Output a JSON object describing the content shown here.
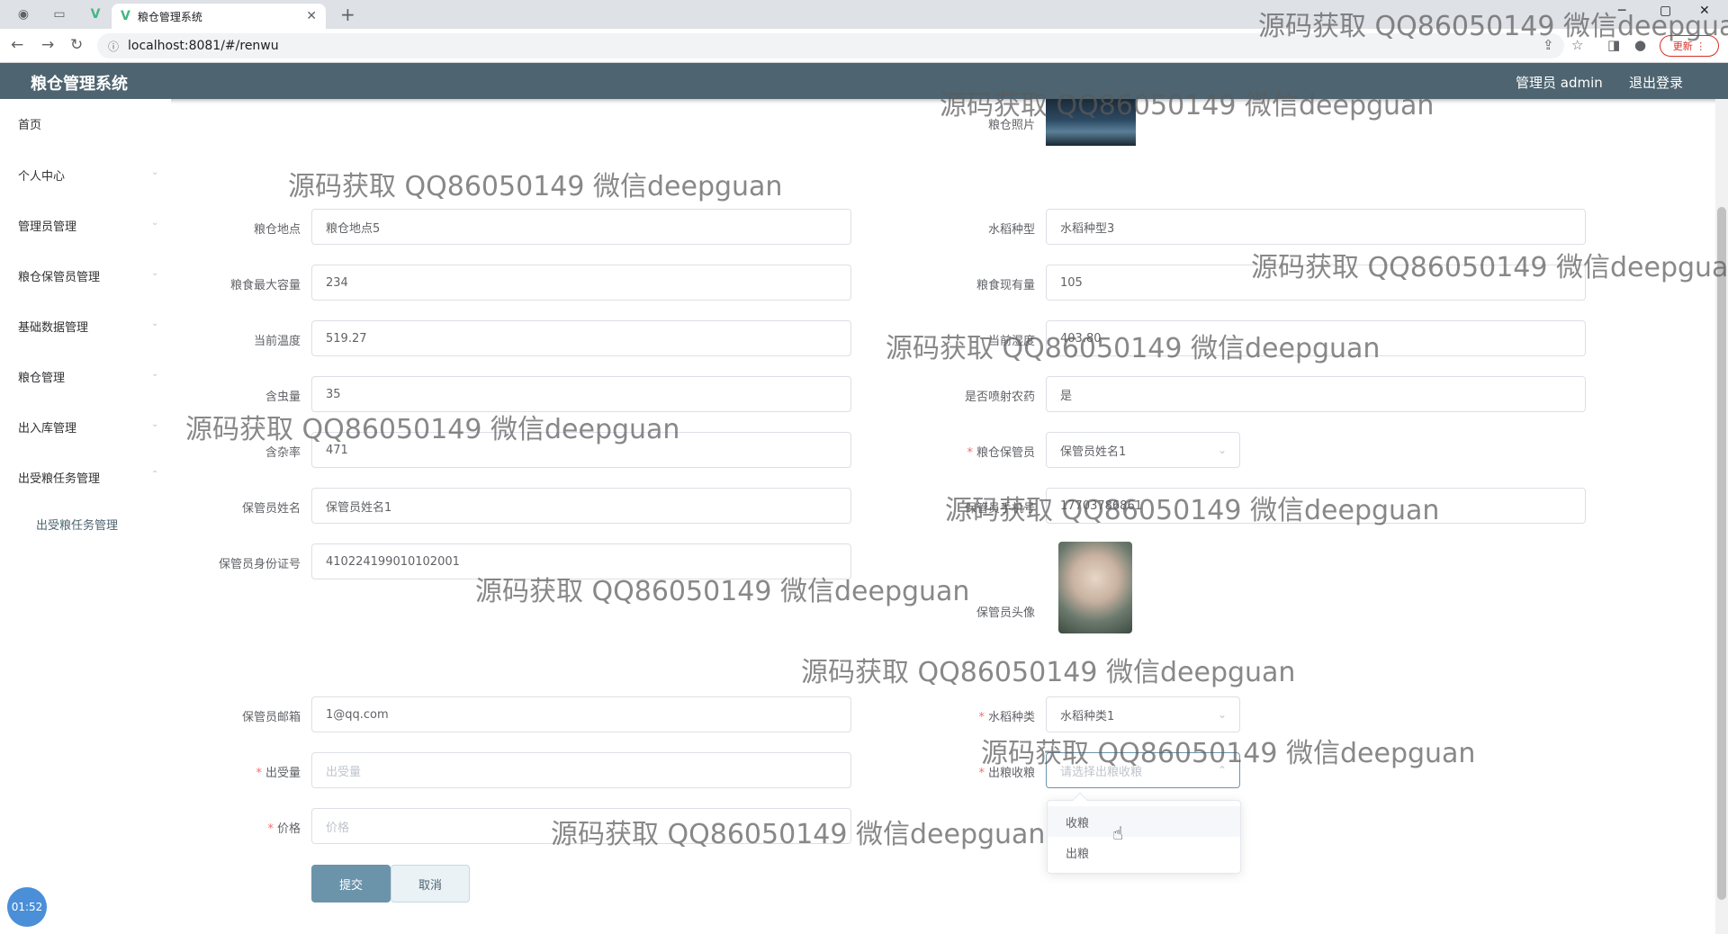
{
  "browser": {
    "tab_title": "粮仓管理系统",
    "url": "localhost:8081/#/renwu",
    "update_label": "更新"
  },
  "header": {
    "title": "粮仓管理系统",
    "user": "管理员 admin",
    "logout": "退出登录"
  },
  "sidebar": {
    "items": [
      {
        "label": "首页"
      },
      {
        "label": "个人中心"
      },
      {
        "label": "管理员管理"
      },
      {
        "label": "粮仓保管员管理"
      },
      {
        "label": "基础数据管理"
      },
      {
        "label": "粮仓管理"
      },
      {
        "label": "出入库管理"
      },
      {
        "label": "出受粮任务管理"
      }
    ],
    "sub_item": "出受粮任务管理"
  },
  "form": {
    "photo_label": "粮仓照片",
    "location": {
      "label": "粮仓地点",
      "value": "粮仓地点5"
    },
    "rice_type_text": {
      "label": "水稻种型",
      "value": "水稻种型3"
    },
    "max_capacity": {
      "label": "粮食最大容量",
      "value": "234"
    },
    "current_amount": {
      "label": "粮食现有量",
      "value": "105"
    },
    "current_temp": {
      "label": "当前温度",
      "value": "519.27"
    },
    "current_humidity": {
      "label": "当前湿度",
      "value": "403.80"
    },
    "insect": {
      "label": "含虫量",
      "value": "35"
    },
    "pesticide": {
      "label": "是否喷射农药",
      "value": "是"
    },
    "impurity": {
      "label": "含杂率",
      "value": "471"
    },
    "keeper_select": {
      "label": "粮仓保管员",
      "value": "保管员姓名1"
    },
    "keeper_name": {
      "label": "保管员姓名",
      "value": "保管员姓名1"
    },
    "keeper_phone": {
      "label": "保管员手机号",
      "value": "17703786861"
    },
    "keeper_id": {
      "label": "保管员身份证号",
      "value": "410224199010102001"
    },
    "keeper_avatar_label": "保管员头像",
    "keeper_email": {
      "label": "保管员邮箱",
      "value": "1@qq.com"
    },
    "rice_kind": {
      "label": "水稻种类",
      "value": "水稻种类1"
    },
    "out_amount": {
      "label": "出受量",
      "placeholder": "出受量"
    },
    "in_out": {
      "label": "出粮收粮",
      "placeholder": "请选择出粮收粮"
    },
    "price": {
      "label": "价格",
      "placeholder": "价格"
    },
    "submit": "提交",
    "cancel": "取消"
  },
  "dropdown": {
    "options": [
      "收粮",
      "出粮"
    ]
  },
  "clock": "01:52",
  "watermark": "源码获取 QQ86050149 微信deepguan"
}
